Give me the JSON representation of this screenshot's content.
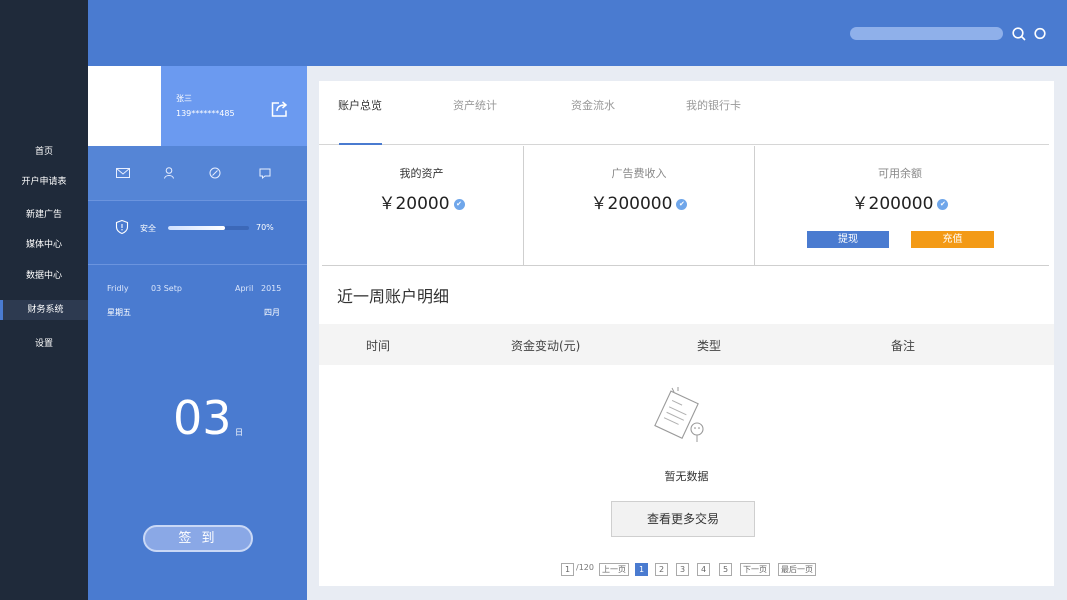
{
  "nav": {
    "items": [
      {
        "label": "首页"
      },
      {
        "label": "开户申请表"
      },
      {
        "label": "新建广告"
      },
      {
        "label": "媒体中心"
      },
      {
        "label": "数据中心"
      },
      {
        "label": "财务系统",
        "active": true
      },
      {
        "label": "设置"
      }
    ]
  },
  "topbar": {
    "search_placeholder": "",
    "icons": [
      "search-icon",
      "circle-icon"
    ]
  },
  "profile": {
    "name": "张三",
    "phone": "139*******485",
    "share_icon": "share-icon",
    "row_icons": [
      "mail-icon",
      "user-icon",
      "attachment-icon",
      "chat-icon"
    ],
    "safety_label": "安全",
    "safety_percent_label": "70%",
    "safety_value": 70
  },
  "date": {
    "weekday_en": "Fridly",
    "date_en": "03 Setp",
    "month_en": "April",
    "year": "2015",
    "weekday_cn": "星期五",
    "month_cn": "四月",
    "day": "03",
    "day_unit": "日"
  },
  "signin_label": "签 到",
  "tabs": [
    {
      "label": "账户总览",
      "active": true
    },
    {
      "label": "资产统计"
    },
    {
      "label": "资金流水"
    },
    {
      "label": "我的银行卡"
    }
  ],
  "stats": [
    {
      "label": "我的资产",
      "value": "￥20000"
    },
    {
      "label": "广告费收入",
      "value": "￥200000"
    },
    {
      "label": "可用余额",
      "value": "￥200000"
    }
  ],
  "actions": {
    "withdraw": "提现",
    "recharge": "充值"
  },
  "colors": {
    "primary": "#4a7bd0",
    "accent_orange": "#f39a16",
    "nav_bg": "#1f2a3a",
    "verified": "#6fa6ea"
  },
  "section_title": "近一周账户明细",
  "table": {
    "headers": [
      "时间",
      "资金变动(元)",
      "类型",
      "备注"
    ]
  },
  "empty": {
    "text": "暂无数据",
    "more_button": "查看更多交易"
  },
  "pager": {
    "current_page_box": "1",
    "total": "/120",
    "prev": "上一页",
    "pages": [
      "1",
      "2",
      "3",
      "4",
      "5"
    ],
    "next": "下一页",
    "last": "最后一页"
  }
}
